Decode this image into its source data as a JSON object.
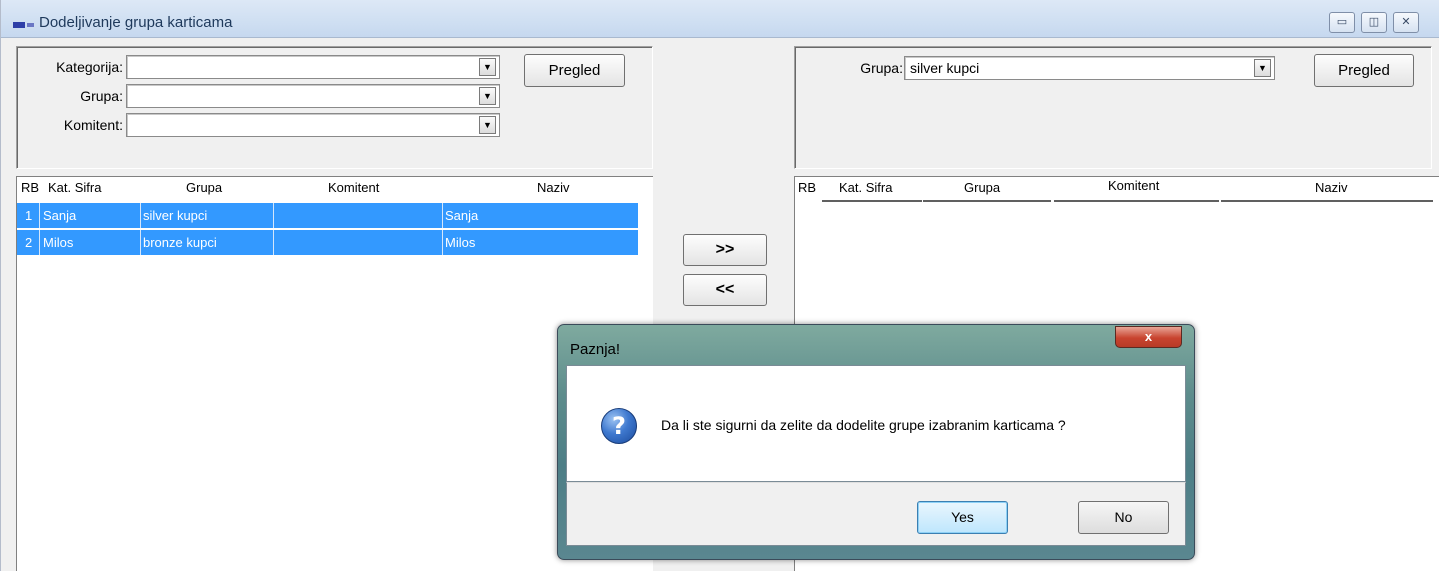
{
  "window": {
    "title": "Dodeljivanje grupa karticama"
  },
  "window_buttons": {
    "minimize": "▭",
    "restore": "◫",
    "close": "✕"
  },
  "left_filter": {
    "kategorija_label": "Kategorija:",
    "kategorija_value": "",
    "grupa_label": "Grupa:",
    "grupa_value": "",
    "komitent_label": "Komitent:",
    "komitent_value": "",
    "pregled_label": "Pregled"
  },
  "right_filter": {
    "grupa_label": "Grupa:",
    "grupa_value": "silver kupci",
    "pregled_label": "Pregled"
  },
  "combo_arrow": "▼",
  "transfer": {
    "right_label": ">>",
    "left_label": "<<"
  },
  "left_grid": {
    "columns": [
      "RB",
      "Kat. Sifra",
      "Grupa",
      "Komitent",
      "Naziv"
    ],
    "rows": [
      {
        "rb": "1",
        "sifra": "Sanja",
        "grupa": "silver kupci",
        "komitent": "",
        "naziv": "Sanja"
      },
      {
        "rb": "2",
        "sifra": "Milos",
        "grupa": "bronze kupci",
        "komitent": "",
        "naziv": "Milos"
      }
    ]
  },
  "right_grid": {
    "columns": [
      "RB",
      "Kat. Sifra",
      "Grupa",
      "Komitent",
      "Naziv"
    ],
    "rows": []
  },
  "dialog": {
    "title": "Paznja!",
    "message": "Da li ste sigurni da zelite da dodelite grupe izabranim karticama ?",
    "yes_label": "Yes",
    "no_label": "No",
    "close_glyph": "x",
    "icon": "question-icon",
    "icon_glyph": "?"
  },
  "colors": {
    "selection": "#3399ff",
    "panel": "#f0f0f0"
  }
}
